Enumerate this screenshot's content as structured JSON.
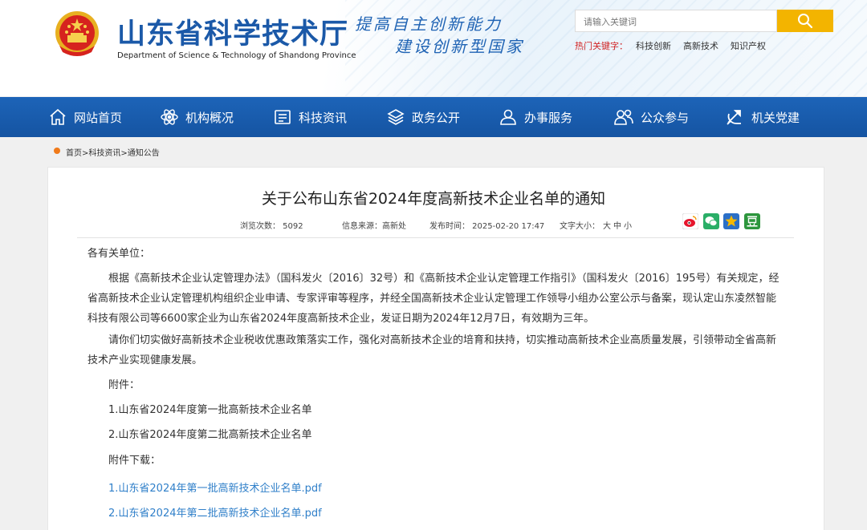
{
  "header": {
    "title": "山东省科学技术厅",
    "subtitle": "Department of Science & Technology of Shandong Province",
    "slogan_line1": "提高自主创新能力",
    "slogan_line2": "建设创新型国家",
    "search_placeholder": "请输入关键词",
    "hot_label": "热门关键字：",
    "hot_keywords": [
      "科技创新",
      "高新技术",
      "知识产权"
    ]
  },
  "nav": {
    "items": [
      {
        "label": "网站首页",
        "icon": "home-icon"
      },
      {
        "label": "机构概况",
        "icon": "atom-icon"
      },
      {
        "label": "科技资讯",
        "icon": "news-icon"
      },
      {
        "label": "政务公开",
        "icon": "layers-icon"
      },
      {
        "label": "办事服务",
        "icon": "service-user-icon"
      },
      {
        "label": "公众参与",
        "icon": "people-icon"
      },
      {
        "label": "机关党建",
        "icon": "party-emblem-icon"
      }
    ]
  },
  "breadcrumb": "首页>科技资讯>通知公告",
  "article": {
    "title": "关于公布山东省2024年度高新技术企业名单的通知",
    "views": "浏览次数： 5092",
    "source": "信息来源：高新处",
    "publish_time": "发布时间： 2025-02-20 17:47",
    "font_size_label": "文字大小：",
    "font_sizes": [
      "大",
      "中",
      "小"
    ],
    "share_icons": [
      {
        "name": "weibo-icon",
        "color": "#e6162d"
      },
      {
        "name": "wechat-icon",
        "color": "#2aae67"
      },
      {
        "name": "qzone-star-icon",
        "color": "#f6b800"
      },
      {
        "name": "douban-icon",
        "color": "#2d963d"
      }
    ],
    "salutation": "各有关单位：",
    "para1": "根据《高新技术企业认定管理办法》（国科发火〔2016〕32号）和《高新技术企业认定管理工作指引》（国科发火〔2016〕195号）有关规定，经省高新技术企业认定管理机构组织企业申请、专家评审等程序，并经全国高新技术企业认定管理工作领导小组办公室公示与备案，现认定山东凌然智能科技有限公司等6600家企业为山东省2024年度高新技术企业，发证日期为2024年12月7日，有效期为三年。",
    "para2": "请你们切实做好高新技术企业税收优惠政策落实工作，强化对高新技术企业的培育和扶持，切实推动高新技术企业高质量发展，引领带动全省高新技术产业实现健康发展。",
    "attachments_label": "附件：",
    "attachments": [
      "1.山东省2024年度第一批高新技术企业名单",
      "2.山东省2024年度第二批高新技术企业名单"
    ],
    "downloads_label": "附件下载：",
    "downloads": [
      "1.山东省2024年第一批高新技术企业名单.pdf",
      "2.山东省2024年第二批高新技术企业名单.pdf"
    ]
  },
  "colors": {
    "brand_blue": "#1b59a8",
    "nav_blue": "#1a5eb0",
    "search_button": "#f3b400",
    "hot_red": "#d02323",
    "link_blue": "#2f7fc9",
    "crumb_dot": "#f07a1a"
  }
}
